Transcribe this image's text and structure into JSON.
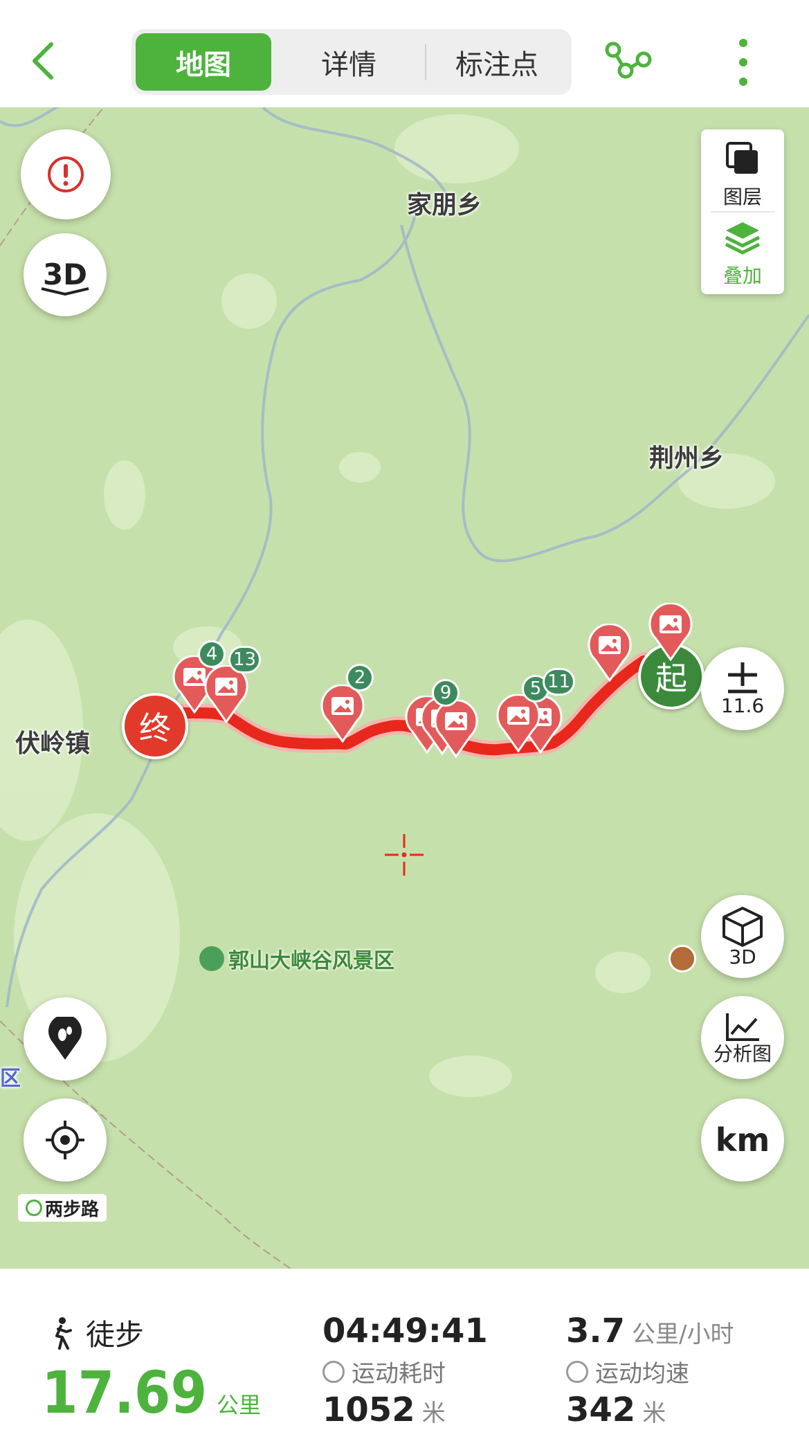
{
  "topbar": {
    "tabs": [
      {
        "label": "地图",
        "active": true
      },
      {
        "label": "详情",
        "active": false
      },
      {
        "label": "标注点",
        "active": false
      }
    ],
    "back_icon": "chevron-left-icon",
    "route_icon": "route-nodes-icon",
    "more_icon": "more-vertical-icon",
    "accent_color": "#4db33d"
  },
  "map": {
    "places": {
      "jiapeng": "家朋乡",
      "jingzhou": "荆州乡",
      "fuling": "伏岭镇",
      "district_fragment": "区"
    },
    "poi": {
      "label": "郭山大峡谷风景区",
      "icon": "scenic-area-icon"
    },
    "controls": {
      "alert_icon": "alert-icon",
      "three_d_icon": "3d-icon",
      "layers_label": "图层",
      "overlay_label": "叠加",
      "zoom_level": "11.6",
      "view3d_label": "3D",
      "analysis_label": "分析图",
      "unit_label": "km",
      "footprint_icon": "footprint-pin-icon",
      "locate_icon": "locate-icon",
      "brand_label": "两步路"
    },
    "route": {
      "start_label": "起",
      "end_label": "终",
      "badges": [
        "4",
        "13",
        "2",
        "9",
        "5",
        "11"
      ],
      "route_color": "#e8281c"
    }
  },
  "stats": {
    "sport_type": "徒步",
    "distance": "17.69",
    "distance_unit": "公里",
    "duration": "04:49:41",
    "duration_label": "运动耗时",
    "avg_speed": "3.7",
    "avg_speed_unit": "公里/小时",
    "avg_speed_label": "运动均速",
    "stat_a": "1052",
    "stat_a_unit": "米",
    "stat_b": "342",
    "stat_b_unit": "米"
  }
}
